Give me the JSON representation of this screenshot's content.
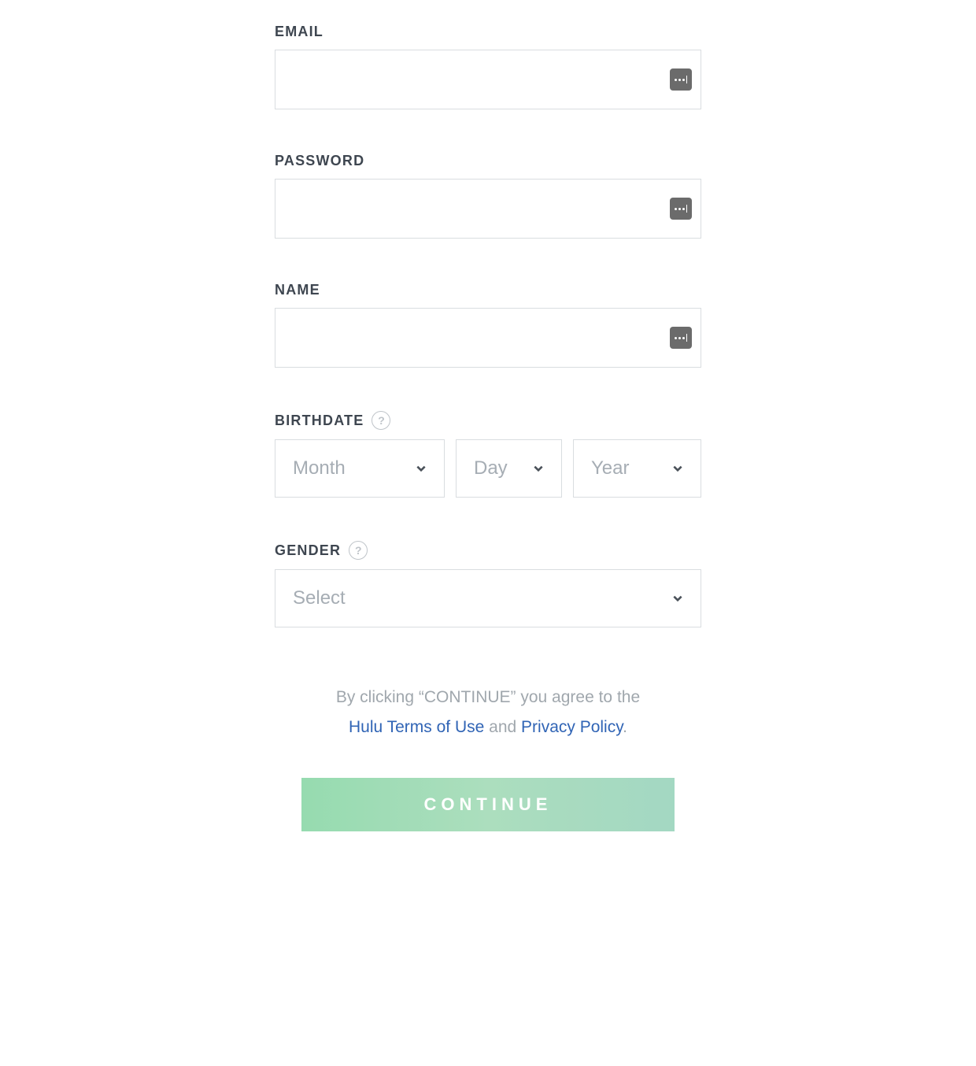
{
  "form": {
    "email": {
      "label": "EMAIL",
      "value": ""
    },
    "password": {
      "label": "PASSWORD",
      "value": ""
    },
    "name": {
      "label": "NAME",
      "value": ""
    },
    "birthdate": {
      "label": "BIRTHDATE",
      "month_placeholder": "Month",
      "day_placeholder": "Day",
      "year_placeholder": "Year"
    },
    "gender": {
      "label": "GENDER",
      "placeholder": "Select"
    }
  },
  "legal": {
    "prefix": "By clicking “CONTINUE” you agree to the",
    "terms_link": "Hulu Terms of Use",
    "and_text": " and ",
    "privacy_link": "Privacy Policy",
    "suffix": "."
  },
  "actions": {
    "continue_label": "CONTINUE"
  },
  "icons": {
    "help_glyph": "?"
  }
}
